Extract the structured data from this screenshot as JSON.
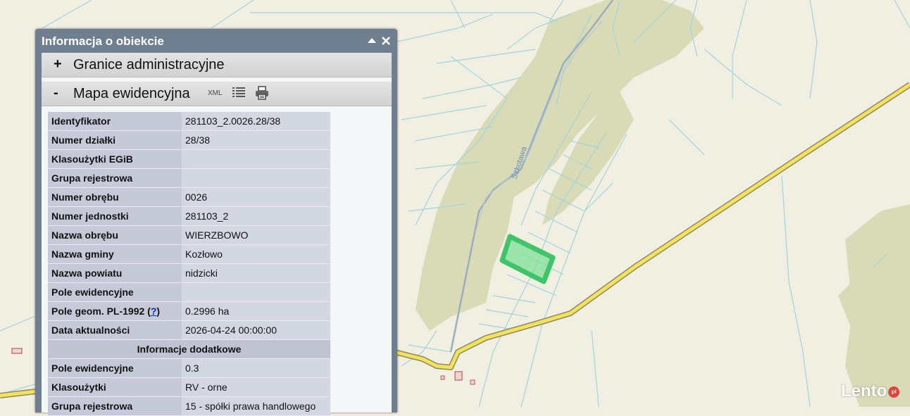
{
  "map": {
    "street_label": "Szkotawa",
    "colors": {
      "background": "#f1eee2",
      "forest": "#d8dbb6",
      "parcel_line": "#9fd6dc",
      "road_fill": "#f6e25a",
      "road_edge": "#8b8a66",
      "highlight": "#4cd47a"
    }
  },
  "panel": {
    "title": "Informacja o obiekcie",
    "collapse_icon": "triangle-up-icon",
    "close_icon": "close-icon",
    "sections": [
      {
        "sign": "+",
        "title": "Granice administracyjne"
      },
      {
        "sign": "-",
        "title": "Mapa ewidencyjna",
        "xml": "XML"
      }
    ]
  },
  "attributes": {
    "rows": [
      {
        "label": "Identyfikator",
        "value": "281103_2.0026.28/38"
      },
      {
        "label": "Numer działki",
        "value": "28/38"
      },
      {
        "label": "Klasoużytki EGiB",
        "value": ""
      },
      {
        "label": "Grupa rejestrowa",
        "value": ""
      },
      {
        "label": "Numer obrębu",
        "value": "0026"
      },
      {
        "label": "Numer jednostki",
        "value": "281103_2"
      },
      {
        "label": "Nazwa obrębu",
        "value": "WIERZBOWO"
      },
      {
        "label": "Nazwa gminy",
        "value": "Kozłowo"
      },
      {
        "label": "Nazwa powiatu",
        "value": "nidzicki"
      },
      {
        "label": "Pole ewidencyjne",
        "value": ""
      },
      {
        "label": "Pole geom. PL-1992 (",
        "help": "?",
        "suffix": ")",
        "value": "0.2996 ha"
      },
      {
        "label": "Data aktualności",
        "value": "2026-04-24 00:00:00"
      }
    ],
    "extra_header": "Informacje dodatkowe",
    "extra_rows": [
      {
        "label": "Pole ewidencyjne",
        "value": "0.3"
      },
      {
        "label": "Klasoużytki",
        "value": "RV - orne"
      },
      {
        "label": "Grupa rejestrowa",
        "value": "15 - spółki prawa handlowego"
      }
    ]
  },
  "watermark": {
    "text": "Lento",
    "badge": "pl"
  }
}
